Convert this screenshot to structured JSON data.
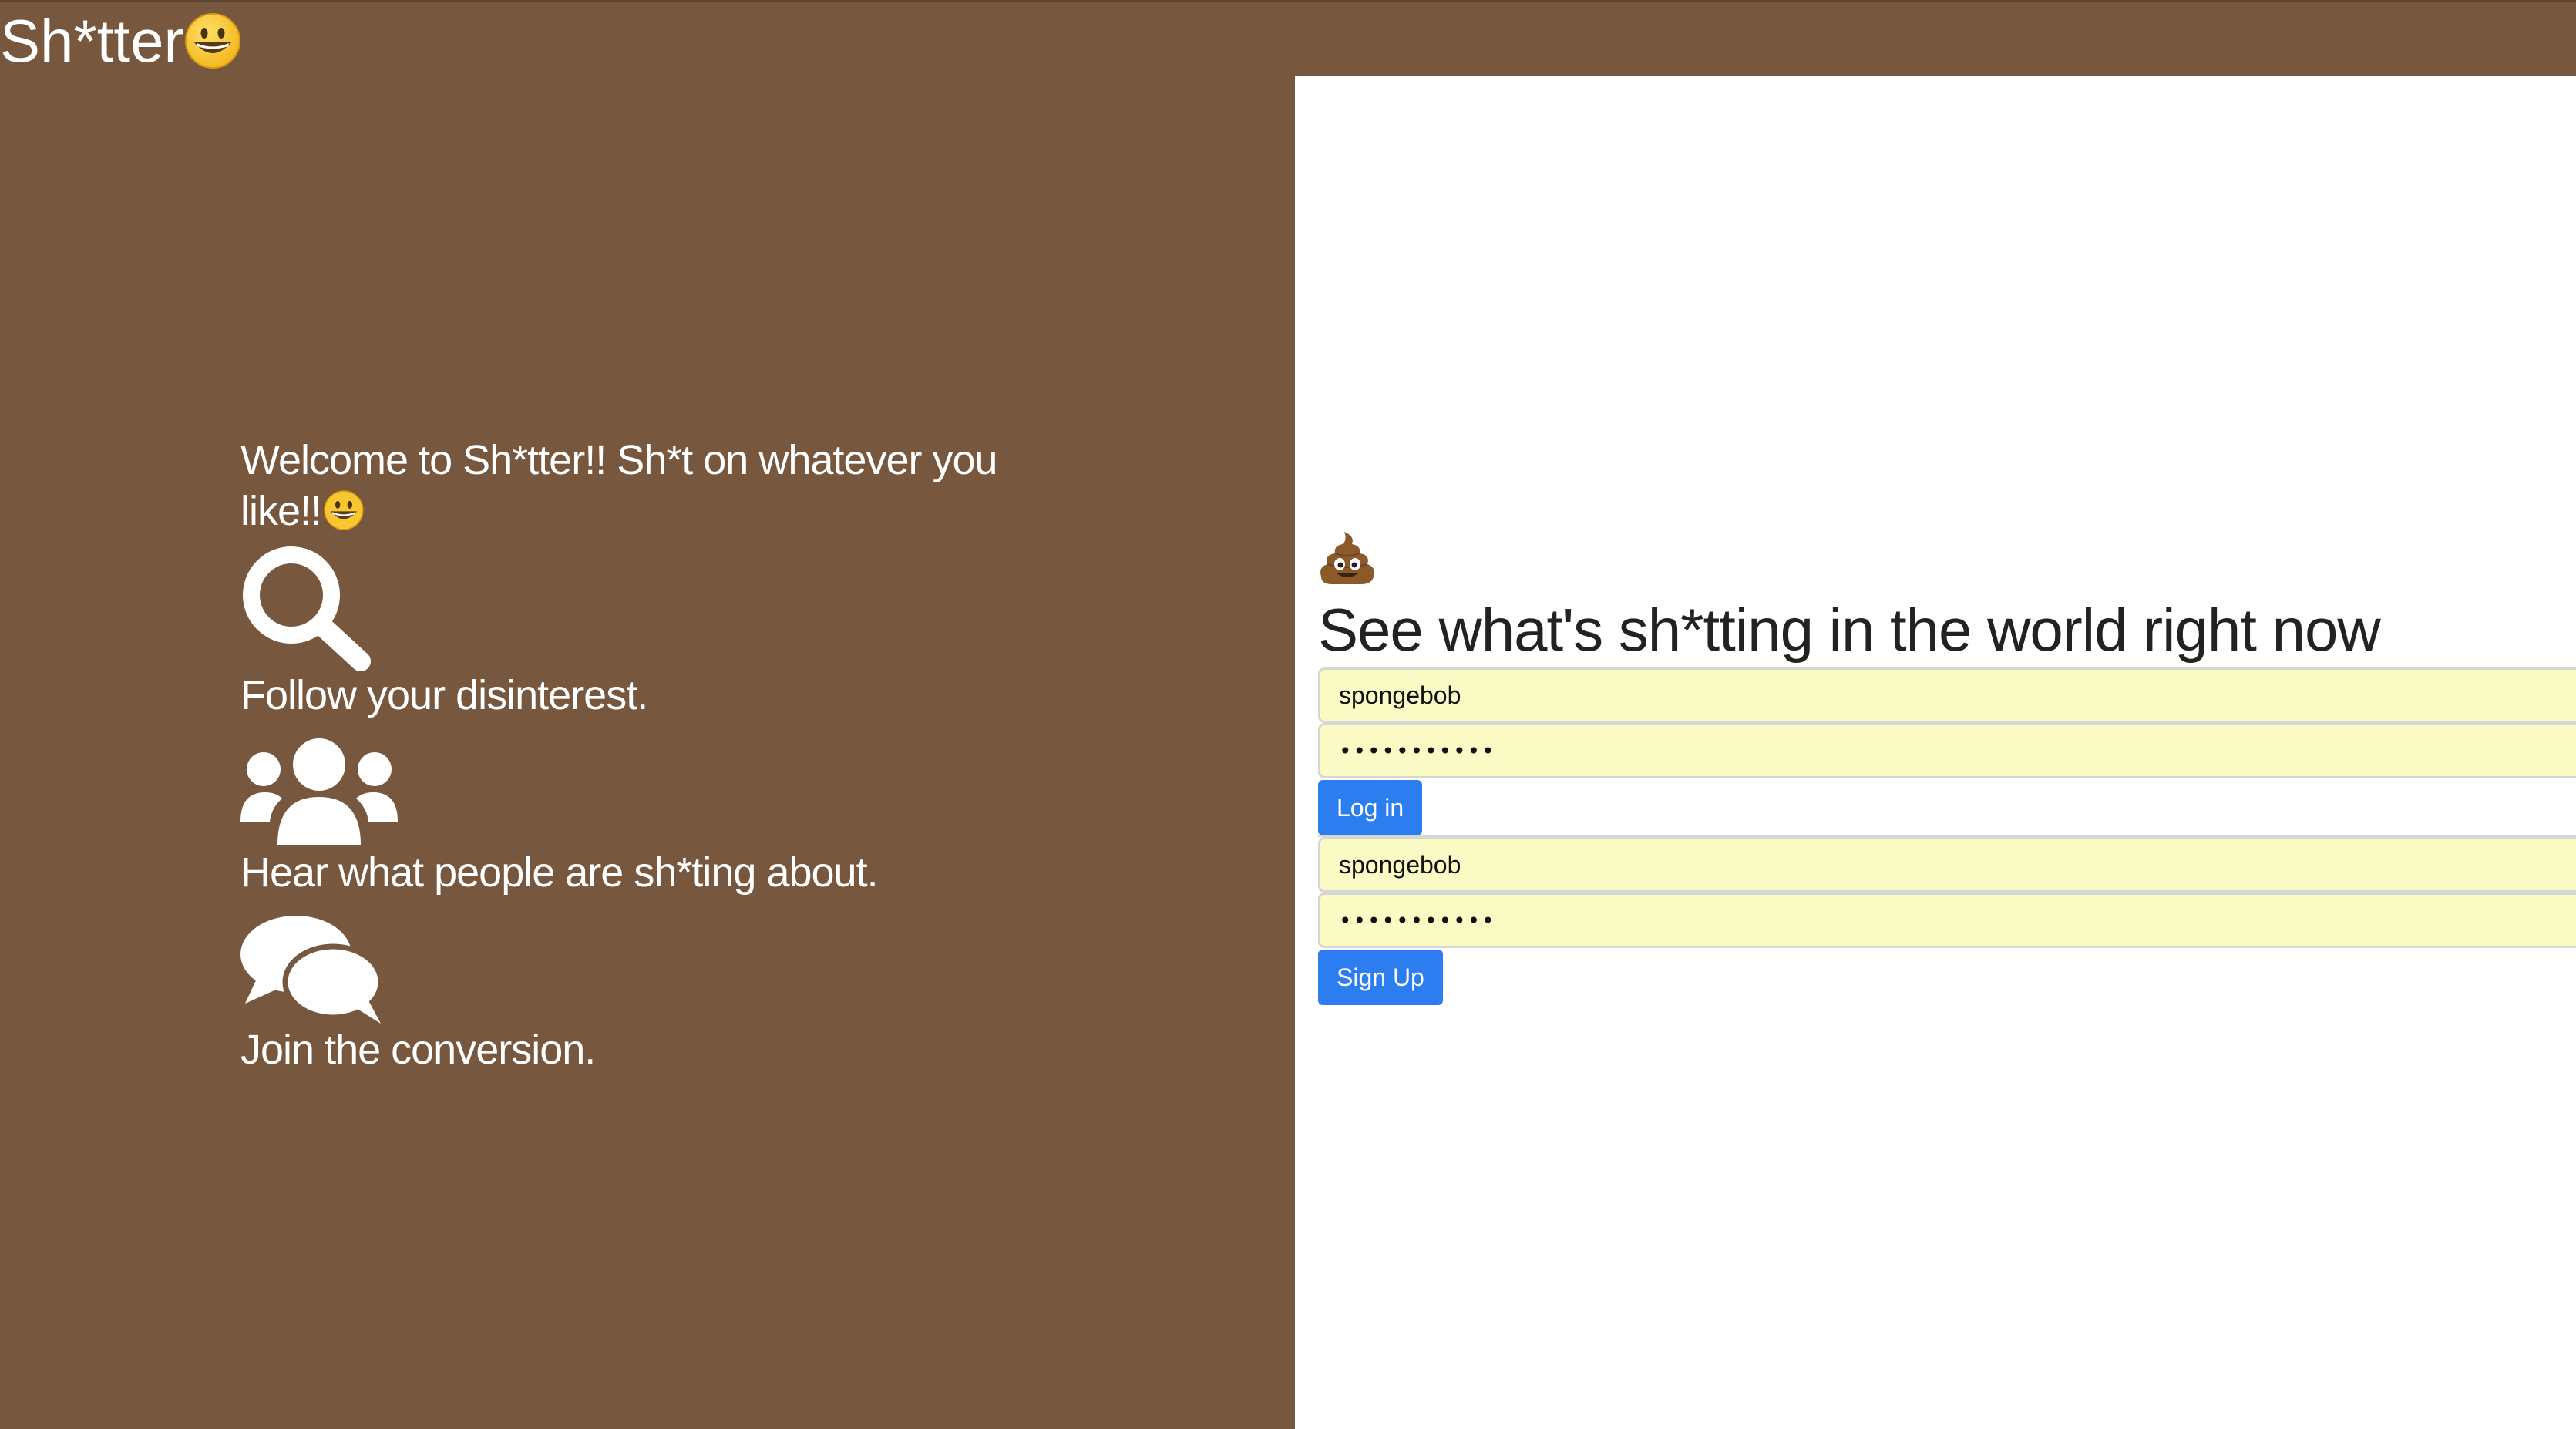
{
  "header": {
    "brand": "Sh*tter"
  },
  "intro": {
    "welcome": "Welcome to Sh*tter!! Sh*t on whatever you like!!",
    "features": [
      {
        "icon": "search-icon",
        "text": "Follow your disinterest."
      },
      {
        "icon": "users-icon",
        "text": "Hear what people are sh*ting about."
      },
      {
        "icon": "comments-icon",
        "text": "Join the conversion."
      }
    ]
  },
  "login": {
    "heading": "See what's sh*tting in the world right now",
    "username_value": "spongebob",
    "password_value": "spongebob12",
    "login_label": "Log in"
  },
  "signup": {
    "username_value": "spongebob",
    "password_value": "spongebob12",
    "signup_label": "Sign Up"
  },
  "colors": {
    "brand_brown": "#77573d",
    "button_blue": "#2c7ef0",
    "autofill_yellow": "#fafac5"
  }
}
